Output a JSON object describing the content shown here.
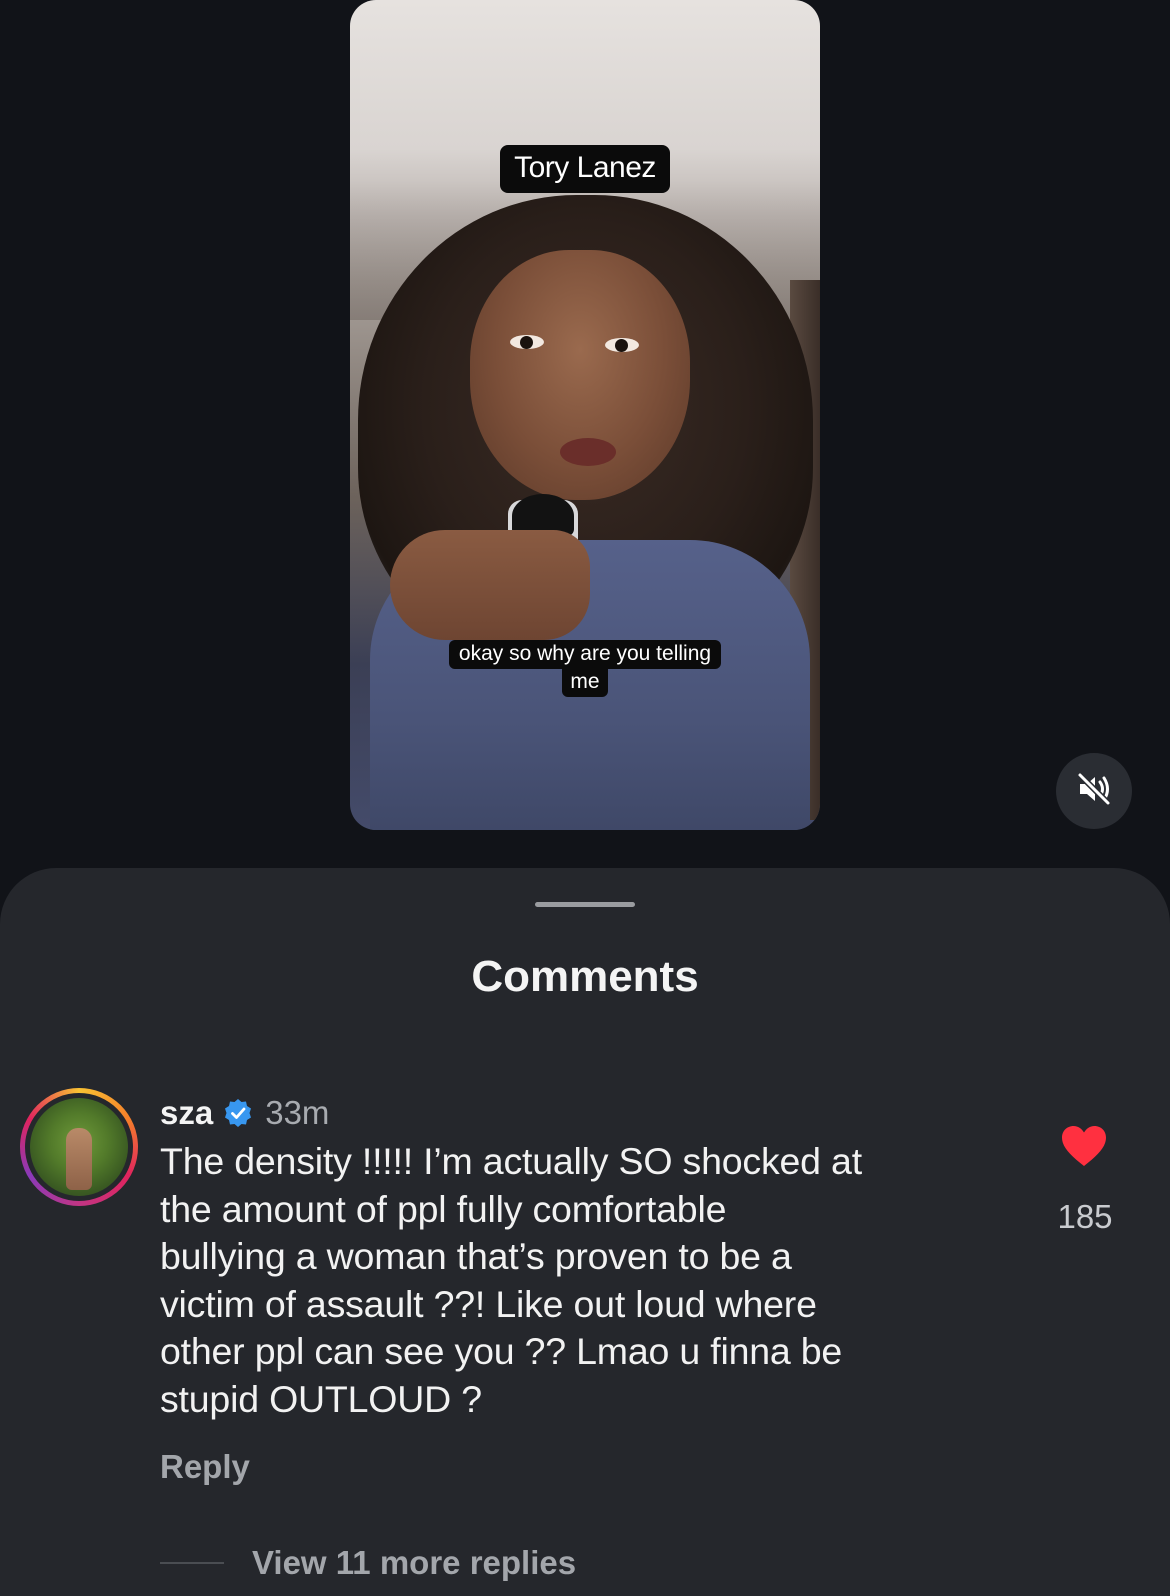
{
  "video": {
    "caption_top": "Tory Lanez",
    "caption_bottom_line1": "okay so why are you telling",
    "caption_bottom_line2": "me",
    "mute_icon": "speaker-muted-icon"
  },
  "comments_sheet": {
    "title": "Comments",
    "comment": {
      "username": "sza",
      "verified_icon": "verified-badge-icon",
      "time": "33m",
      "text": "The density !!!!! I’m actually SO shocked at\nthe amount of ppl fully comfortable\nbullying a woman that’s proven to be a\nvictim of assault ??! Like out loud where\nother ppl can see you ?? Lmao u finna be\nstupid OUTLOUD ?",
      "reply_label": "Reply",
      "like_icon": "heart-icon",
      "like_count": "185",
      "view_replies_label": "View 11 more replies"
    }
  },
  "colors": {
    "background": "#111318",
    "sheet": "#25272c",
    "like_red": "#ff3040",
    "verified_blue": "#3897f0"
  }
}
